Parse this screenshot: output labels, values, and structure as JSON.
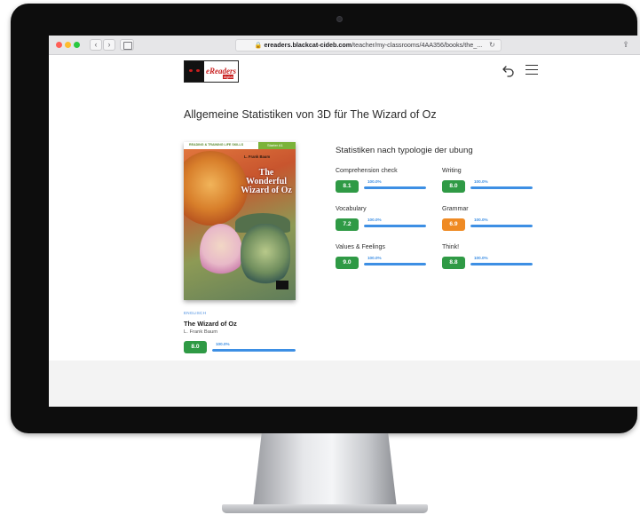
{
  "browser": {
    "url_host": "ereaders.blackcat-cideb.com",
    "url_path": "/teacher/my-classrooms/4AA356/books/the_...",
    "back_label": "‹",
    "forward_label": "›",
    "lock_glyph": "🔒",
    "reload_glyph": "↻",
    "share_glyph": "⇪"
  },
  "header": {
    "logo_text": "eReaders",
    "logo_sub": "digital"
  },
  "page": {
    "title": "Allgemeine Statistiken von 3D für The Wizard of Oz"
  },
  "book": {
    "cover": {
      "series": "READING & TRAINING  LIFE SKILLS",
      "band": "Starter A1",
      "author": "L. Frank Baum",
      "title": "The Wonderful Wizard of Oz"
    },
    "language": "ENGLISCH",
    "title": "The Wizard of Oz",
    "author": "L. Frank Baum",
    "score": "8.0",
    "percent_label": "100.0%",
    "percent_value": 100,
    "color": "#2f9a45"
  },
  "stats": {
    "title": "Statistiken nach typologie der ubung",
    "items": [
      {
        "label": "Comprehension check",
        "score": "8.1",
        "percent_label": "100.0%",
        "percent_value": 100,
        "color": "#2f9a45"
      },
      {
        "label": "Writing",
        "score": "8.0",
        "percent_label": "100.0%",
        "percent_value": 100,
        "color": "#2f9a45"
      },
      {
        "label": "Vocabulary",
        "score": "7.2",
        "percent_label": "100.0%",
        "percent_value": 100,
        "color": "#2f9a45"
      },
      {
        "label": "Grammar",
        "score": "6.9",
        "percent_label": "100.0%",
        "percent_value": 100,
        "color": "#ef8a23"
      },
      {
        "label": "Values & Feelings",
        "score": "9.0",
        "percent_label": "100.0%",
        "percent_value": 100,
        "color": "#2f9a45"
      },
      {
        "label": "Think!",
        "score": "8.8",
        "percent_label": "100.0%",
        "percent_value": 100,
        "color": "#2f9a45"
      }
    ]
  },
  "colors": {
    "accent_blue": "#3d8fe4",
    "score_green": "#2f9a45",
    "score_orange": "#ef8a23"
  }
}
